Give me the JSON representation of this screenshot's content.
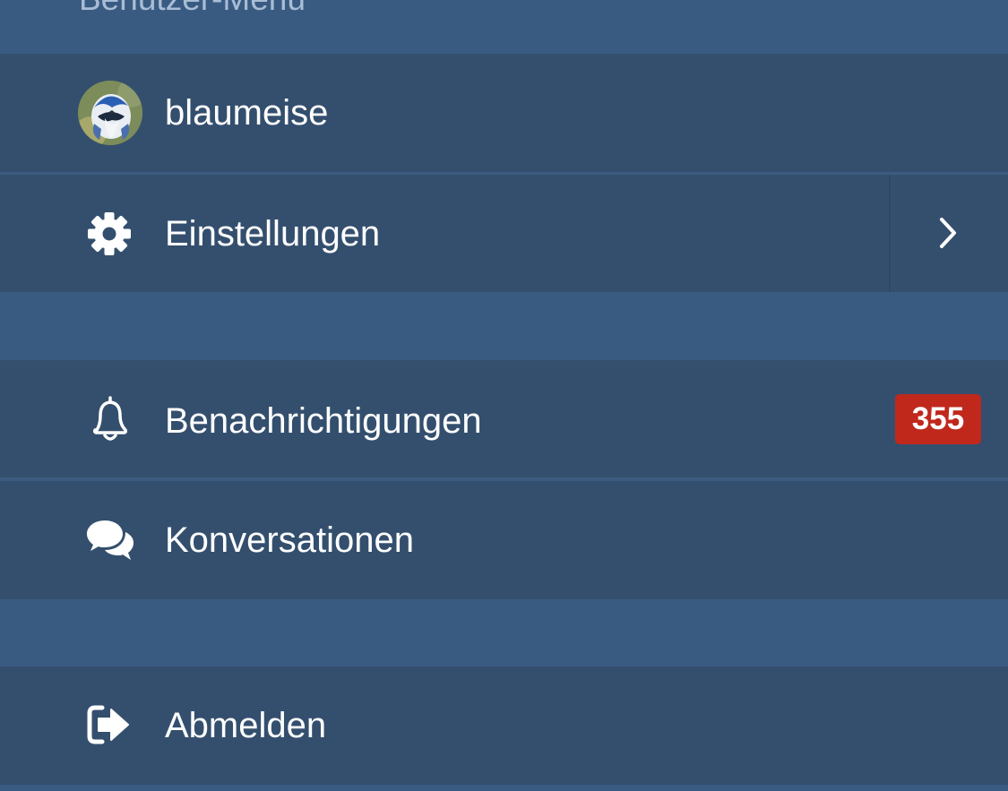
{
  "section": {
    "title": "Benutzer-Menü"
  },
  "user": {
    "username": "blaumeise",
    "avatar_icon": "blue-tit-avatar"
  },
  "menu": {
    "settings_label": "Einstellungen",
    "notifications_label": "Benachrichtigungen",
    "notifications_count": "355",
    "conversations_label": "Konversationen",
    "logout_label": "Abmelden"
  },
  "icons": {
    "settings": "gear-icon",
    "submenu": "chevron-right-icon",
    "notifications": "bell-icon",
    "conversations": "chat-bubbles-icon",
    "logout": "sign-out-icon"
  },
  "colors": {
    "background": "#3a5b81",
    "item_background": "#344f6e",
    "header_text": "#a8bdd6",
    "text": "#ffffff",
    "badge": "#c0281c"
  }
}
